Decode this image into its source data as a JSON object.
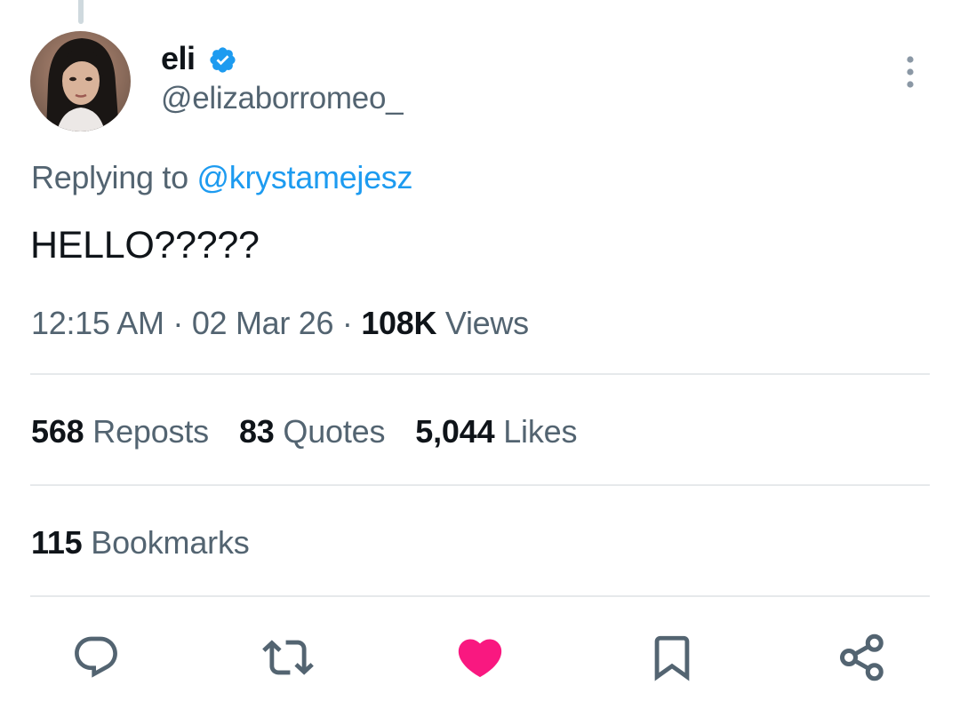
{
  "tweet": {
    "author": {
      "display_name": "eli",
      "handle": "@elizaborromeo_",
      "verified": true,
      "avatar_icon": "profile-photo",
      "verified_icon": "verified-badge-icon"
    },
    "reply": {
      "prefix": "Replying to",
      "mention": "@krystamejesz"
    },
    "text": "HELLO?????",
    "meta": {
      "time": "12:15 AM",
      "separator": "·",
      "date": "02 Mar 26",
      "views_count": "108K",
      "views_label": "Views"
    },
    "stats": [
      {
        "count": "568",
        "label": "Reposts"
      },
      {
        "count": "83",
        "label": "Quotes"
      },
      {
        "count": "5,044",
        "label": "Likes"
      }
    ],
    "bookmarks": {
      "count": "115",
      "label": "Bookmarks"
    },
    "actions": [
      {
        "name": "reply",
        "icon": "reply-icon"
      },
      {
        "name": "repost",
        "icon": "repost-icon"
      },
      {
        "name": "like",
        "icon": "heart-icon",
        "liked": true
      },
      {
        "name": "bookmark",
        "icon": "bookmark-icon"
      },
      {
        "name": "share",
        "icon": "share-icon"
      }
    ]
  },
  "colors": {
    "text_primary": "#0f1419",
    "text_secondary": "#536471",
    "accent_blue": "#1d9bf0",
    "like_pink": "#f91880",
    "divider": "#e6e9eb"
  }
}
